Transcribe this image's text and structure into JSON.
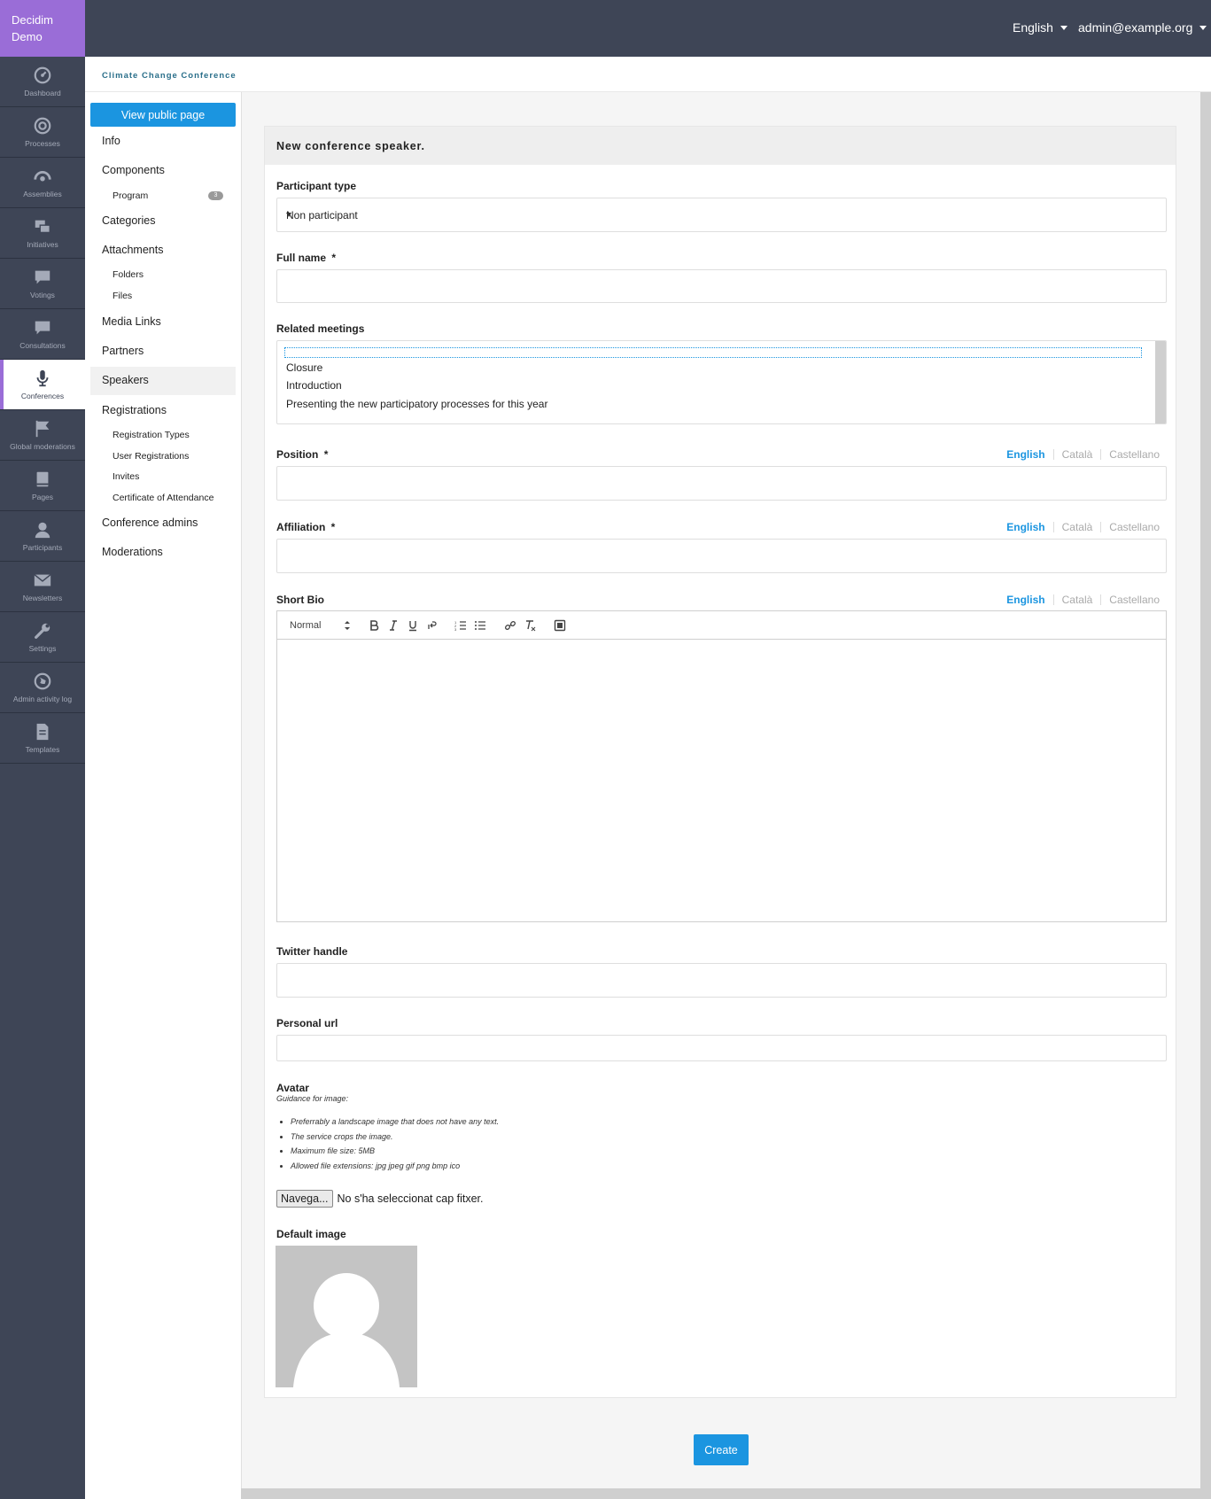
{
  "brand": {
    "line1": "Decidim",
    "line2": "Demo"
  },
  "main_nav": [
    {
      "label": "Dashboard",
      "icon": "dashboard-icon"
    },
    {
      "label": "Processes",
      "icon": "processes-icon"
    },
    {
      "label": "Assemblies",
      "icon": "assemblies-icon"
    },
    {
      "label": "Initiatives",
      "icon": "initiatives-icon"
    },
    {
      "label": "Votings",
      "icon": "votings-icon"
    },
    {
      "label": "Consultations",
      "icon": "consultations-icon"
    },
    {
      "label": "Conferences",
      "icon": "microphone-icon",
      "active": true
    },
    {
      "label": "Global moderations",
      "icon": "flag-icon"
    },
    {
      "label": "Pages",
      "icon": "book-icon"
    },
    {
      "label": "Participants",
      "icon": "person-icon"
    },
    {
      "label": "Newsletters",
      "icon": "envelope-icon"
    },
    {
      "label": "Settings",
      "icon": "wrench-icon"
    },
    {
      "label": "Admin activity log",
      "icon": "globe-icon"
    },
    {
      "label": "Templates",
      "icon": "document-icon"
    }
  ],
  "topbar": {
    "language": "English",
    "user": "admin@example.org"
  },
  "breadcrumb": {
    "space_title": "Climate Change Conference"
  },
  "secondary_nav": {
    "view_public": "View public page",
    "info": "Info",
    "components": "Components",
    "program": "Program",
    "program_count": "3",
    "categories": "Categories",
    "attachments": "Attachments",
    "folders": "Folders",
    "files": "Files",
    "media_links": "Media Links",
    "partners": "Partners",
    "speakers": "Speakers",
    "registrations": "Registrations",
    "registration_types": "Registration Types",
    "user_registrations": "User Registrations",
    "invites": "Invites",
    "certificate": "Certificate of Attendance",
    "conference_admins": "Conference admins",
    "moderations": "Moderations"
  },
  "form": {
    "title": "New conference speaker.",
    "participant_type": {
      "label": "Participant type",
      "value": "Non participant"
    },
    "full_name": {
      "label": "Full name",
      "required": "*",
      "value": ""
    },
    "related_meetings": {
      "label": "Related meetings",
      "options": [
        "",
        "Closure",
        "Introduction",
        "Presenting the new participatory processes for this year"
      ]
    },
    "position": {
      "label": "Position",
      "required": "*",
      "value": ""
    },
    "affiliation": {
      "label": "Affiliation",
      "required": "*",
      "value": ""
    },
    "short_bio": {
      "label": "Short Bio",
      "format": "Normal"
    },
    "languages": [
      "English",
      "Català",
      "Castellano"
    ],
    "twitter": {
      "label": "Twitter handle",
      "value": ""
    },
    "personal_url": {
      "label": "Personal url",
      "value": ""
    },
    "avatar": {
      "label": "Avatar",
      "guidance_title": "Guidance for image:",
      "guidance": [
        "Preferrably a landscape image that does not have any text.",
        "The service crops the image.",
        "Maximum file size: 5MB",
        "Allowed file extensions: jpg jpeg gif png bmp ico"
      ],
      "browse": "Navega...",
      "no_file": "No s'ha seleccionat cap fitxer."
    },
    "default_image": {
      "label": "Default image"
    },
    "submit": "Create"
  },
  "colors": {
    "sidebar": "#3e4556",
    "brand": "#9a6dd7",
    "primary": "#1b95e0",
    "breadcrumb_text": "#2a6f8a"
  }
}
